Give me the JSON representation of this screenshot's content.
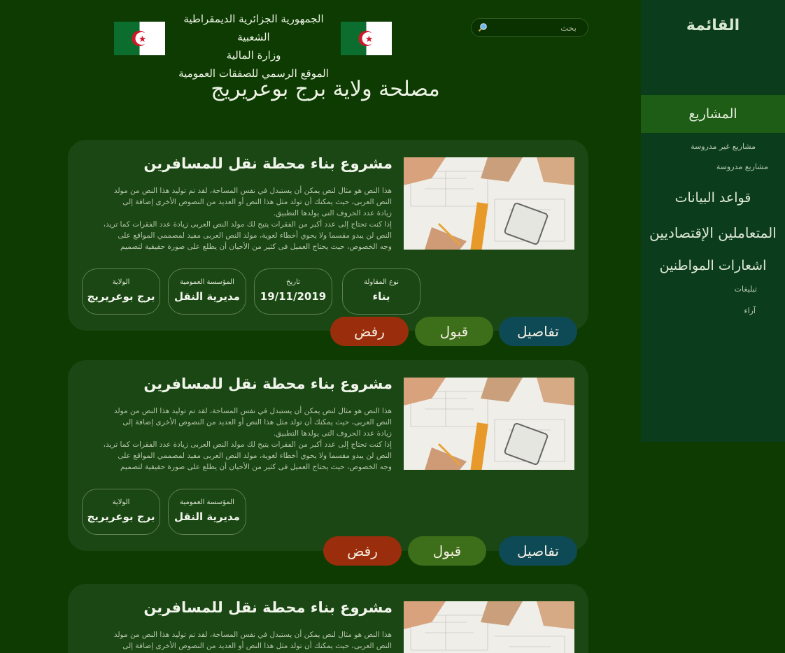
{
  "header": {
    "gov_lines": [
      "الجمهورية الجزائرية الديمقراطية الشعبية",
      "وزارة المالية",
      "الموقع الرسمي للصفقات العمومية"
    ],
    "page_title": "مصلحة ولاية برج بوعريريج",
    "search": {
      "placeholder": "بحث"
    }
  },
  "sidebar": {
    "menu_title": "القائمة",
    "active": "المشاريع",
    "sub_items": [
      "مشاريع غير مدروسة",
      "مشاريع مدروسة"
    ],
    "items": [
      "قواعد البيانات",
      "المتعاملين الإقتصاديين",
      "اشعارات المواطنين"
    ],
    "sub_items2": [
      "تبليغات",
      "آراء"
    ]
  },
  "cards": [
    {
      "title": "مشروع بناء محطة نقل للمسافرين",
      "description_lines": [
        "هذا النص هو مثال لنص يمكن أن يستبدل في نفس المساحة، لقد تم توليد هذا النص من مولد",
        "النص العربى، حيث يمكنك أن تولد مثل هذا النص أو العديد من النصوص الأخرى إضافة إلى",
        "زيادة عدد الحروف التى يولدها التطبيق.",
        "إذا كنت تحتاج إلى عدد أكبر من الفقرات يتيح لك مولد النص العربى زيادة عدد الفقرات كما تريد،",
        "النص لن يبدو مقسما ولا يحوي أخطاء لغوية، مولد النص العربى مفيد لمصممي المواقع على",
        "وجه الخصوص، حيث يحتاج العميل فى كثير من الأحيان أن يطلع على صورة حقيقية لتصميم"
      ],
      "fields": [
        {
          "label": "نوع المقاولة",
          "value": "بناء"
        },
        {
          "label": "تاريخ",
          "value": "19/11/2019"
        },
        {
          "label": "المؤسسة العمومية",
          "value": "مديرية النقل"
        },
        {
          "label": "الولاية",
          "value": "برج بوعريريج"
        }
      ],
      "buttons": {
        "details": "تفاصيل",
        "accept": "قبول",
        "reject": "رفض"
      }
    },
    {
      "title": "مشروع بناء محطة نقل للمسافرين",
      "description_lines": [
        "هذا النص هو مثال لنص يمكن أن يستبدل في نفس المساحة، لقد تم توليد هذا النص من مولد",
        "النص العربى، حيث يمكنك أن تولد مثل هذا النص أو العديد من النصوص الأخرى إضافة إلى",
        "زيادة عدد الحروف التى يولدها التطبيق.",
        "إذا كنت تحتاج إلى عدد أكبر من الفقرات يتيح لك مولد النص العربى زيادة عدد الفقرات كما تريد،",
        "النص لن يبدو مقسما ولا يحوي أخطاء لغوية، مولد النص العربى مفيد لمصممي المواقع على",
        "وجه الخصوص، حيث يحتاج العميل فى كثير من الأحيان أن يطلع على صورة حقيقية لتصميم"
      ],
      "fields": [
        {
          "label": "المؤسسة العمومية",
          "value": "مديرية النقل"
        },
        {
          "label": "الولاية",
          "value": "برج بوعريريج"
        }
      ],
      "buttons": {
        "details": "تفاصيل",
        "accept": "قبول",
        "reject": "رفض"
      }
    },
    {
      "title": "مشروع بناء محطة نقل للمسافرين",
      "description_lines": [
        "هذا النص هو مثال لنص يمكن أن يستبدل في نفس المساحة، لقد تم توليد هذا النص من مولد",
        "النص العربى، حيث يمكنك أن تولد مثل هذا النص أو العديد من النصوص الأخرى إضافة إلى"
      ]
    }
  ],
  "colors": {
    "background": "#0d3b02",
    "sidebar": "#0b3d1c",
    "sidebar_active": "#1e5d16",
    "card": "#1a4713",
    "reject": "#9a2d0c",
    "accept": "#3d6e19",
    "details": "#0e4a56"
  },
  "icons": [
    "search-icon",
    "algeria-flag-icon"
  ]
}
